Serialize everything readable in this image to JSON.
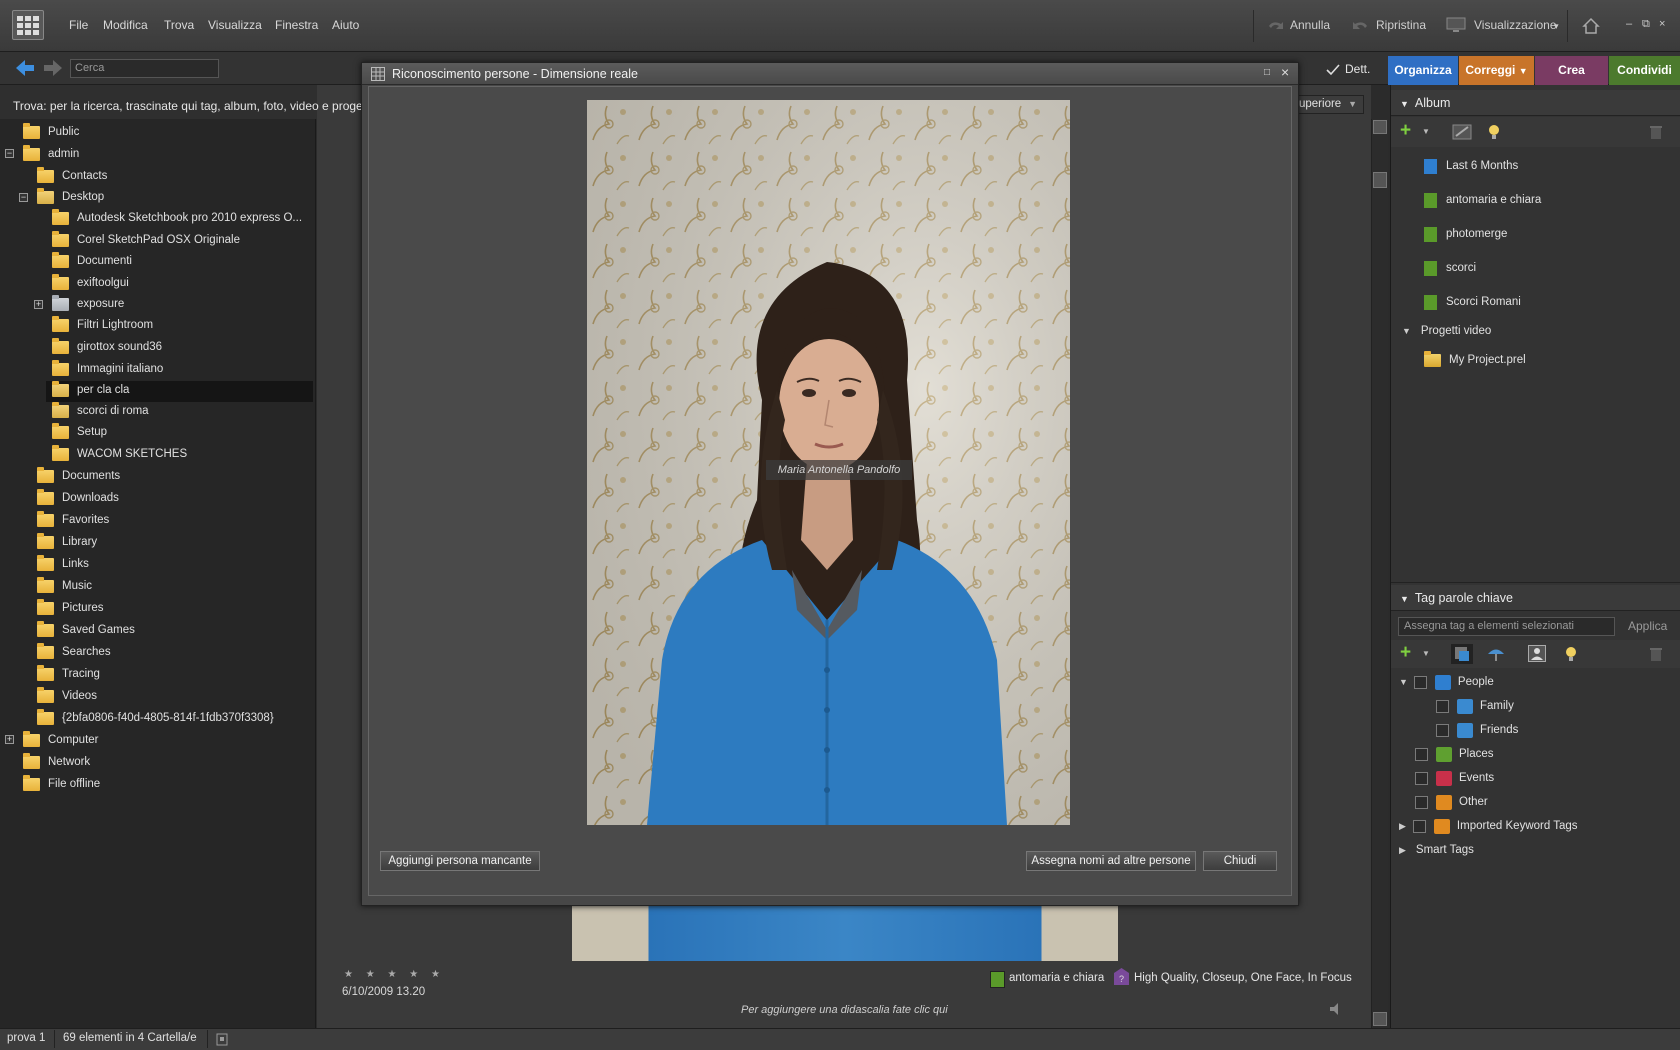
{
  "menu": {
    "items": [
      "File",
      "Modifica",
      "Trova",
      "Visualizza",
      "Finestra",
      "Aiuto"
    ],
    "undo": "Annulla",
    "redo": "Ripristina",
    "view": "Visualizzazione"
  },
  "nav": {
    "search_value": "Cerca",
    "details_label": "Dett.",
    "sort_partial": "uperiore"
  },
  "modes": {
    "organize": "Organizza",
    "fix": "Correggi",
    "create": "Crea",
    "share": "Condividi",
    "colors": {
      "organize": "#2f6fc4",
      "fix": "#c8742a",
      "create": "#7a3b63",
      "share": "#4c7a2d"
    }
  },
  "find": {
    "text": "Trova: per la ricerca, trascinate qui tag, album, foto, video e progetti"
  },
  "tree": {
    "items": [
      {
        "label": "Public"
      },
      {
        "label": "admin"
      },
      {
        "label": "Contacts"
      },
      {
        "label": "Desktop"
      },
      {
        "label": "Autodesk Sketchbook pro 2010 express O..."
      },
      {
        "label": "Corel SketchPad  OSX Originale"
      },
      {
        "label": "Documenti"
      },
      {
        "label": "exiftoolgui"
      },
      {
        "label": "exposure"
      },
      {
        "label": "Filtri Lightroom"
      },
      {
        "label": "girottox sound36"
      },
      {
        "label": "Immagini italiano"
      },
      {
        "label": "per cla cla"
      },
      {
        "label": "scorci di roma"
      },
      {
        "label": "Setup"
      },
      {
        "label": "WACOM SKETCHES"
      },
      {
        "label": "Documents"
      },
      {
        "label": "Downloads"
      },
      {
        "label": "Favorites"
      },
      {
        "label": "Library"
      },
      {
        "label": "Links"
      },
      {
        "label": "Music"
      },
      {
        "label": "Pictures"
      },
      {
        "label": "Saved Games"
      },
      {
        "label": "Searches"
      },
      {
        "label": "Tracing"
      },
      {
        "label": "Videos"
      },
      {
        "label": "{2bfa0806-f40d-4805-814f-1fdb370f3308}"
      },
      {
        "label": "Computer"
      },
      {
        "label": "Network"
      },
      {
        "label": "File offline"
      }
    ],
    "expanders": {
      "admin": "−",
      "desktop": "−",
      "exposure": "+",
      "computer": "+"
    }
  },
  "dialog": {
    "title": "Riconoscimento persone - Dimensione reale",
    "face_name": "Maria Antonella Pandolfo",
    "add_missing": "Aggiungi persona mancante",
    "name_others": "Assegna nomi ad altre persone",
    "close": "Chiudi"
  },
  "item_info": {
    "stars": "★ ★ ★ ★ ★",
    "date": "6/10/2009 13.20",
    "album_tag": "antomaria e chiara",
    "smart_tags": "High Quality, Closeup, One Face, In Focus",
    "caption_hint": "Per aggiungere una didascalia fate clic qui"
  },
  "albums": {
    "header": "Album",
    "items": [
      {
        "label": "Last 6 Months",
        "color": "#2f7fd0"
      },
      {
        "label": "antomaria e chiara",
        "color": "#5a9a2a"
      },
      {
        "label": "photomerge",
        "color": "#5a9a2a"
      },
      {
        "label": "scorci",
        "color": "#5a9a2a"
      },
      {
        "label": "Scorci Romani",
        "color": "#5a9a2a"
      }
    ],
    "video_header": "Progetti video",
    "video_item": "My Project.prel"
  },
  "keywords": {
    "header": "Tag parole chiave",
    "input_placeholder": "Assegna tag a elementi selezionati",
    "apply": "Applica",
    "items": [
      {
        "label": "People"
      },
      {
        "label": "Family"
      },
      {
        "label": "Friends"
      },
      {
        "label": "Places"
      },
      {
        "label": "Events"
      },
      {
        "label": "Other"
      },
      {
        "label": "Imported Keyword Tags"
      },
      {
        "label": "Smart Tags"
      }
    ]
  },
  "status": {
    "catalog": "prova 1",
    "count": "69 elementi in 4 Cartella/e"
  }
}
